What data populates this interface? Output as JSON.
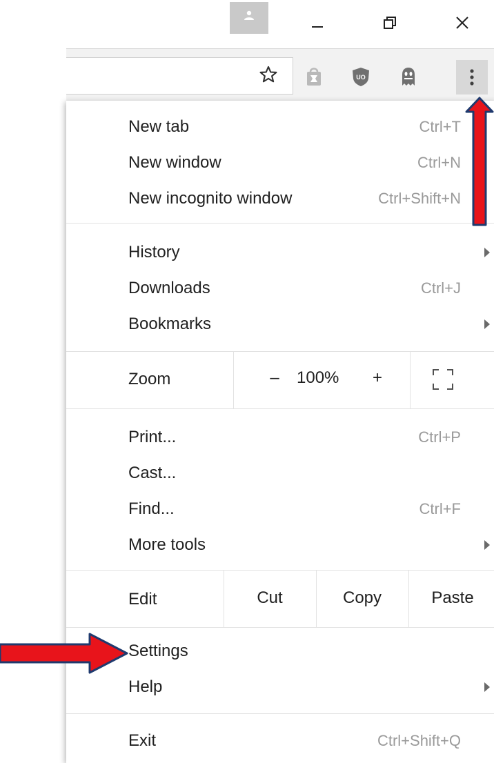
{
  "titlebar": {
    "icons": [
      "profile-icon",
      "minimize-icon",
      "restore-icon",
      "close-icon"
    ]
  },
  "toolbar": {
    "icons": [
      "star-icon",
      "store-extension-icon",
      "ublock-extension-icon",
      "ghostery-extension-icon",
      "more-vertical-icon"
    ]
  },
  "menu": {
    "new_tab": {
      "label": "New tab",
      "shortcut": "Ctrl+T"
    },
    "new_window": {
      "label": "New window",
      "shortcut": "Ctrl+N"
    },
    "new_incognito": {
      "label": "New incognito window",
      "shortcut": "Ctrl+Shift+N"
    },
    "history": {
      "label": "History"
    },
    "downloads": {
      "label": "Downloads",
      "shortcut": "Ctrl+J"
    },
    "bookmarks": {
      "label": "Bookmarks"
    },
    "zoom": {
      "label": "Zoom",
      "minus": "–",
      "value": "100%",
      "plus": "+"
    },
    "print": {
      "label": "Print...",
      "shortcut": "Ctrl+P"
    },
    "cast": {
      "label": "Cast..."
    },
    "find": {
      "label": "Find...",
      "shortcut": "Ctrl+F"
    },
    "more_tools": {
      "label": "More tools"
    },
    "edit": {
      "label": "Edit",
      "cut": "Cut",
      "copy": "Copy",
      "paste": "Paste"
    },
    "settings": {
      "label": "Settings"
    },
    "help": {
      "label": "Help"
    },
    "exit": {
      "label": "Exit",
      "shortcut": "Ctrl+Shift+Q"
    }
  },
  "colors": {
    "annotation_arrow": "#e8141b",
    "annotation_outline": "#1f3a6e"
  }
}
